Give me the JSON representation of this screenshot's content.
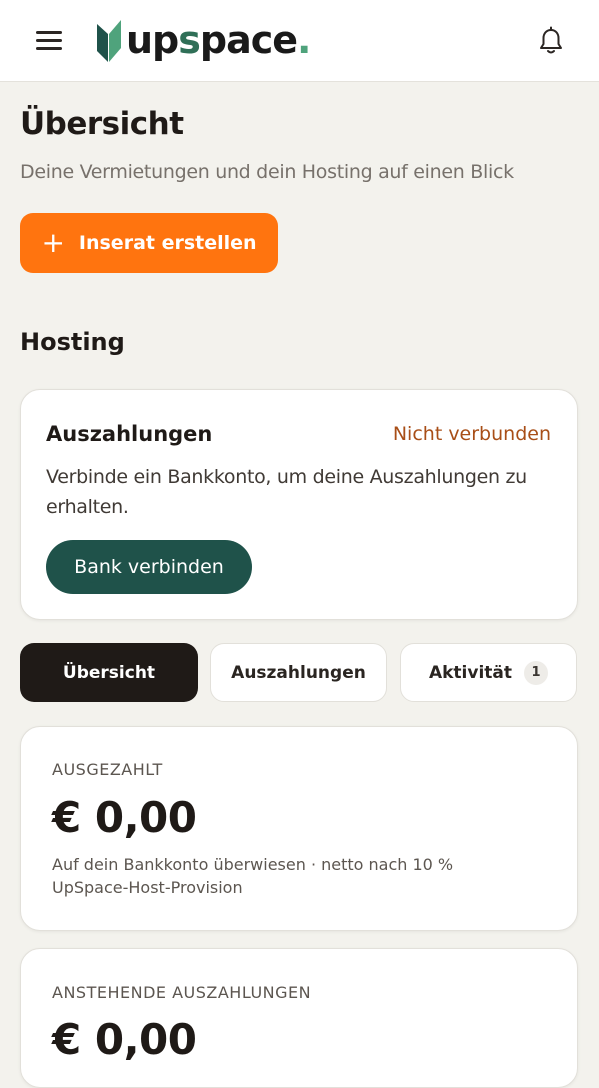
{
  "header": {
    "logo_text_1": "up",
    "logo_text_2": "s",
    "logo_text_3": "pace",
    "logo_dot": ".",
    "menu_icon": "hamburger-icon",
    "notification_icon": "bell-icon"
  },
  "page": {
    "title": "Übersicht",
    "subtitle": "Deine Vermietungen und dein Hosting auf einen Blick",
    "create_button": "Inserat erstellen",
    "create_icon": "+"
  },
  "hosting": {
    "heading": "Hosting",
    "payout_card": {
      "title": "Auszahlungen",
      "status": "Nicht verbunden",
      "description": "Verbinde ein Bankkonto, um deine Auszahlungen zu erhalten.",
      "button": "Bank verbinden"
    }
  },
  "tabs": [
    {
      "label": "Übersicht",
      "active": true
    },
    {
      "label": "Auszahlungen",
      "active": false
    },
    {
      "label": "Aktivität",
      "active": false,
      "badge": "1"
    }
  ],
  "stats": [
    {
      "label": "AUSGEZAHLT",
      "value": "€ 0,00",
      "note": "Auf dein Bankkonto überwiesen · netto nach 10 % UpSpace-Host-Provision"
    },
    {
      "label": "ANSTEHENDE AUSZAHLUNGEN",
      "value": "€ 0,00"
    }
  ],
  "colors": {
    "accent_orange": "#ff740f",
    "bank_button": "#1f524a",
    "status_warning": "#a84e17",
    "background": "#f3f2ed"
  }
}
